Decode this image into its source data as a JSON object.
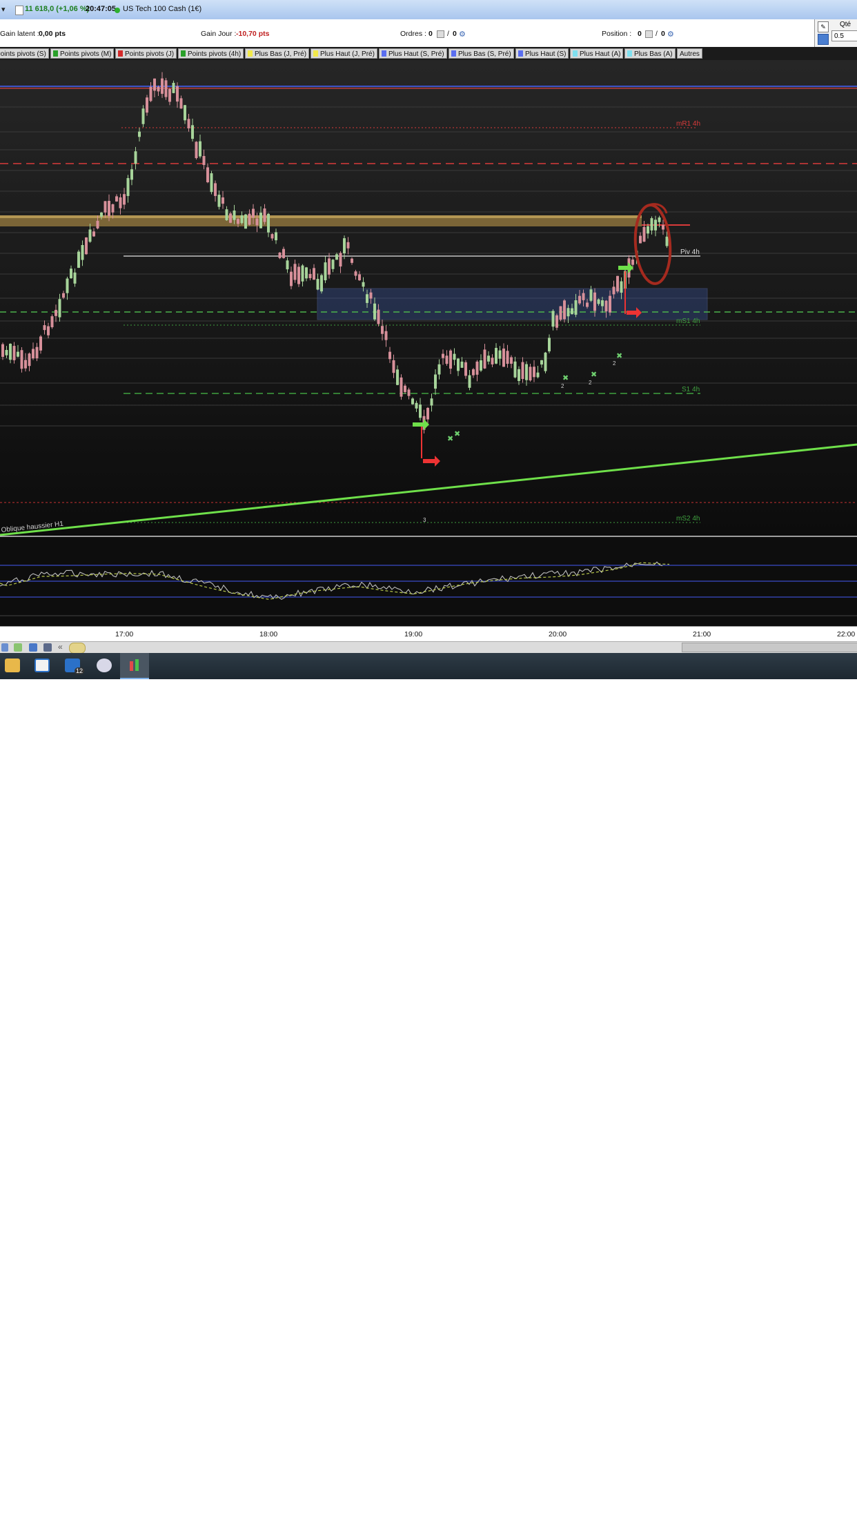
{
  "titlebar": {
    "arrow": "▾",
    "price": "11 618,0 (+1,06 %)",
    "time": "20:47:05",
    "instrument": "US Tech 100 Cash (1€)"
  },
  "infobar": {
    "latent_label": "Gain latent :",
    "latent_value": "0,00 pts",
    "day_label": "Gain Jour :",
    "day_value": "-10,70 pts",
    "orders_label": "Ordres :",
    "orders_value": "0",
    "orders_sep": "/",
    "orders_value2": "0",
    "position_label": "Position :",
    "position_value": "0",
    "position_sep": "/",
    "position_value2": "0"
  },
  "rightpanel": {
    "qty_label": "Qté",
    "qty_value": "0.5"
  },
  "legend": [
    {
      "label": "Points pivots (S)",
      "color": "#d42a2a"
    },
    {
      "label": "Points pivots (M)",
      "color": "#2aa02a"
    },
    {
      "label": "Points pivots (J)",
      "color": "#d42a2a"
    },
    {
      "label": "Points pivots (4h)",
      "color": "#2aa02a"
    },
    {
      "label": "Plus Bas (J, Pré)",
      "color": "#f2e94a"
    },
    {
      "label": "Plus Haut (J, Pré)",
      "color": "#f2e94a"
    },
    {
      "label": "Plus Haut (S, Pré)",
      "color": "#5a6ef0"
    },
    {
      "label": "Plus Bas (S, Pré)",
      "color": "#5a6ef0"
    },
    {
      "label": "Plus Haut (S)",
      "color": "#5a6ef0"
    },
    {
      "label": "Plus Haut (A)",
      "color": "#7fe0ef"
    },
    {
      "label": "Plus Bas (A)",
      "color": "#7fe0ef"
    },
    {
      "label": "Autres",
      "color": ""
    }
  ],
  "chart_labels": {
    "r1": "mR1 4h",
    "piv": "Piv 4h",
    "s1m": "mS1 4h",
    "s1": "S1 4h",
    "s2m": "mS2 4h",
    "trendline": "Oblique haussier H1",
    "marker_2": "2",
    "marker_3": "3"
  },
  "time_axis": [
    "17:00",
    "18:00",
    "19:00",
    "20:00",
    "21:00",
    "22:00"
  ],
  "colors": {
    "up": "#a7d49a",
    "down": "#d7909a",
    "trend": "#6fe04a",
    "resistance": "#d93a3a",
    "support": "#3fa13f",
    "zone": "#3c5aa8",
    "band": "#c9a14d"
  }
}
